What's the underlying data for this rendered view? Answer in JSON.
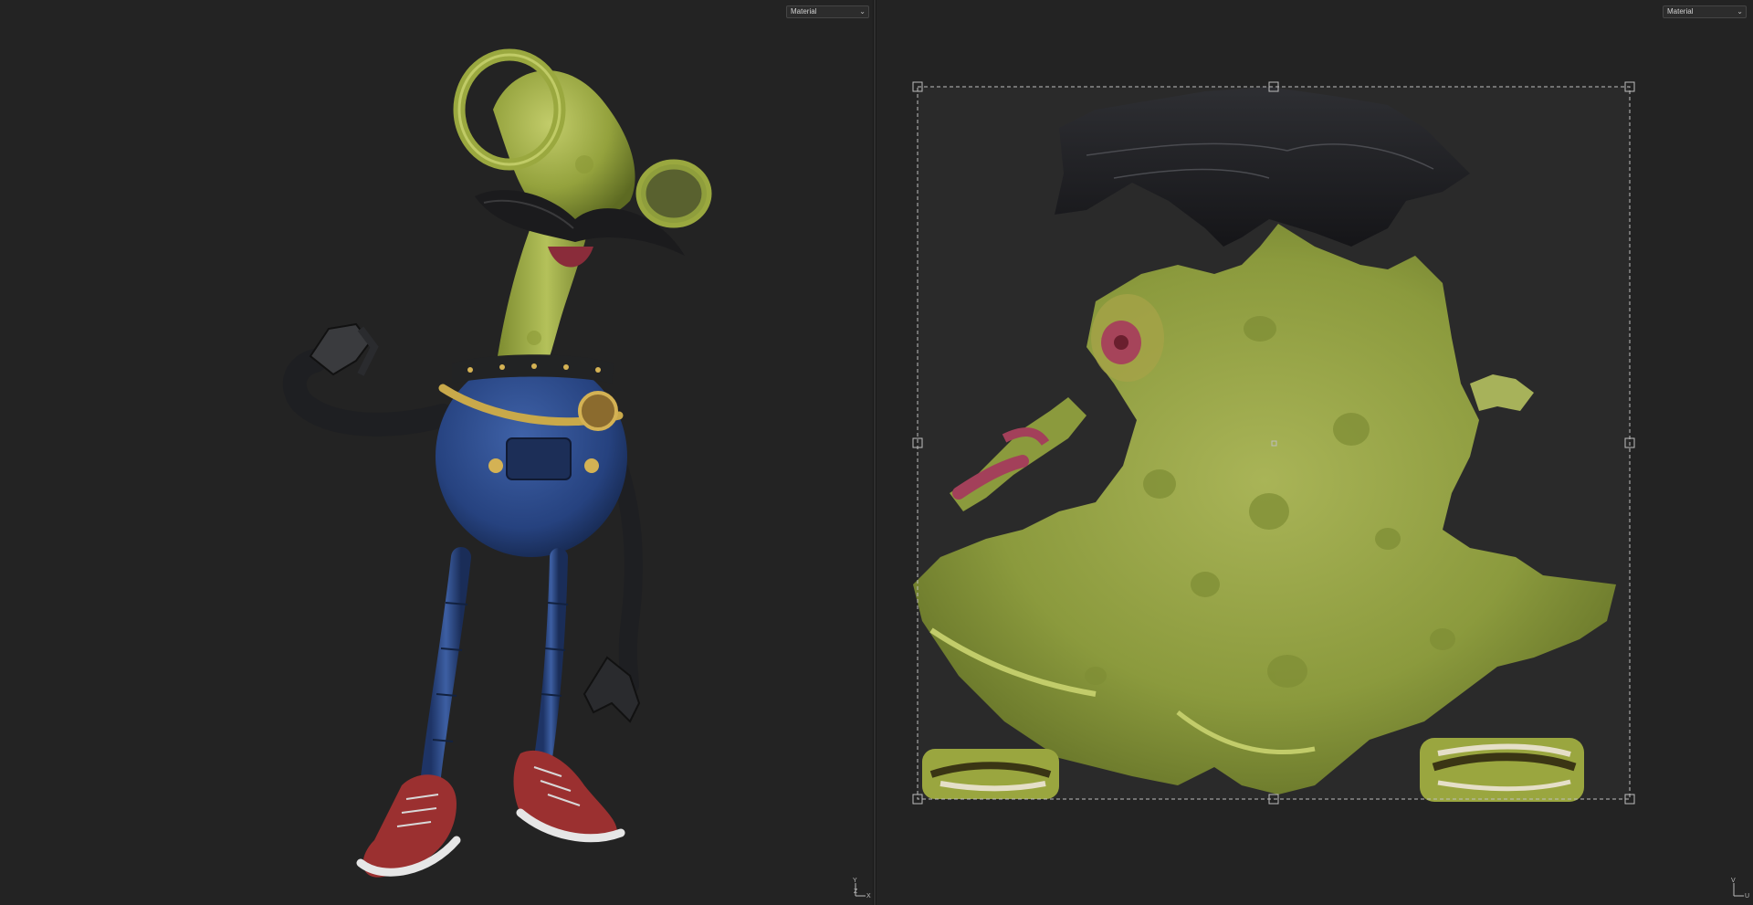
{
  "viewport_3d": {
    "mode_label": "Material",
    "axis": {
      "y": "Y",
      "x": "X",
      "z": "Z"
    }
  },
  "viewport_2d": {
    "mode_label": "Material",
    "axis": {
      "v": "V",
      "u": "U"
    }
  },
  "icons": {
    "dropdown": "chevron-down-icon",
    "axis_gizmo": "axis-gizmo-icon"
  },
  "colors": {
    "viewport_bg": "#232323",
    "character_skin": "#9aa83f",
    "overalls": "#2b4a8a",
    "shoes": "#9b3030",
    "uv_selection": "#bdbdbd"
  }
}
